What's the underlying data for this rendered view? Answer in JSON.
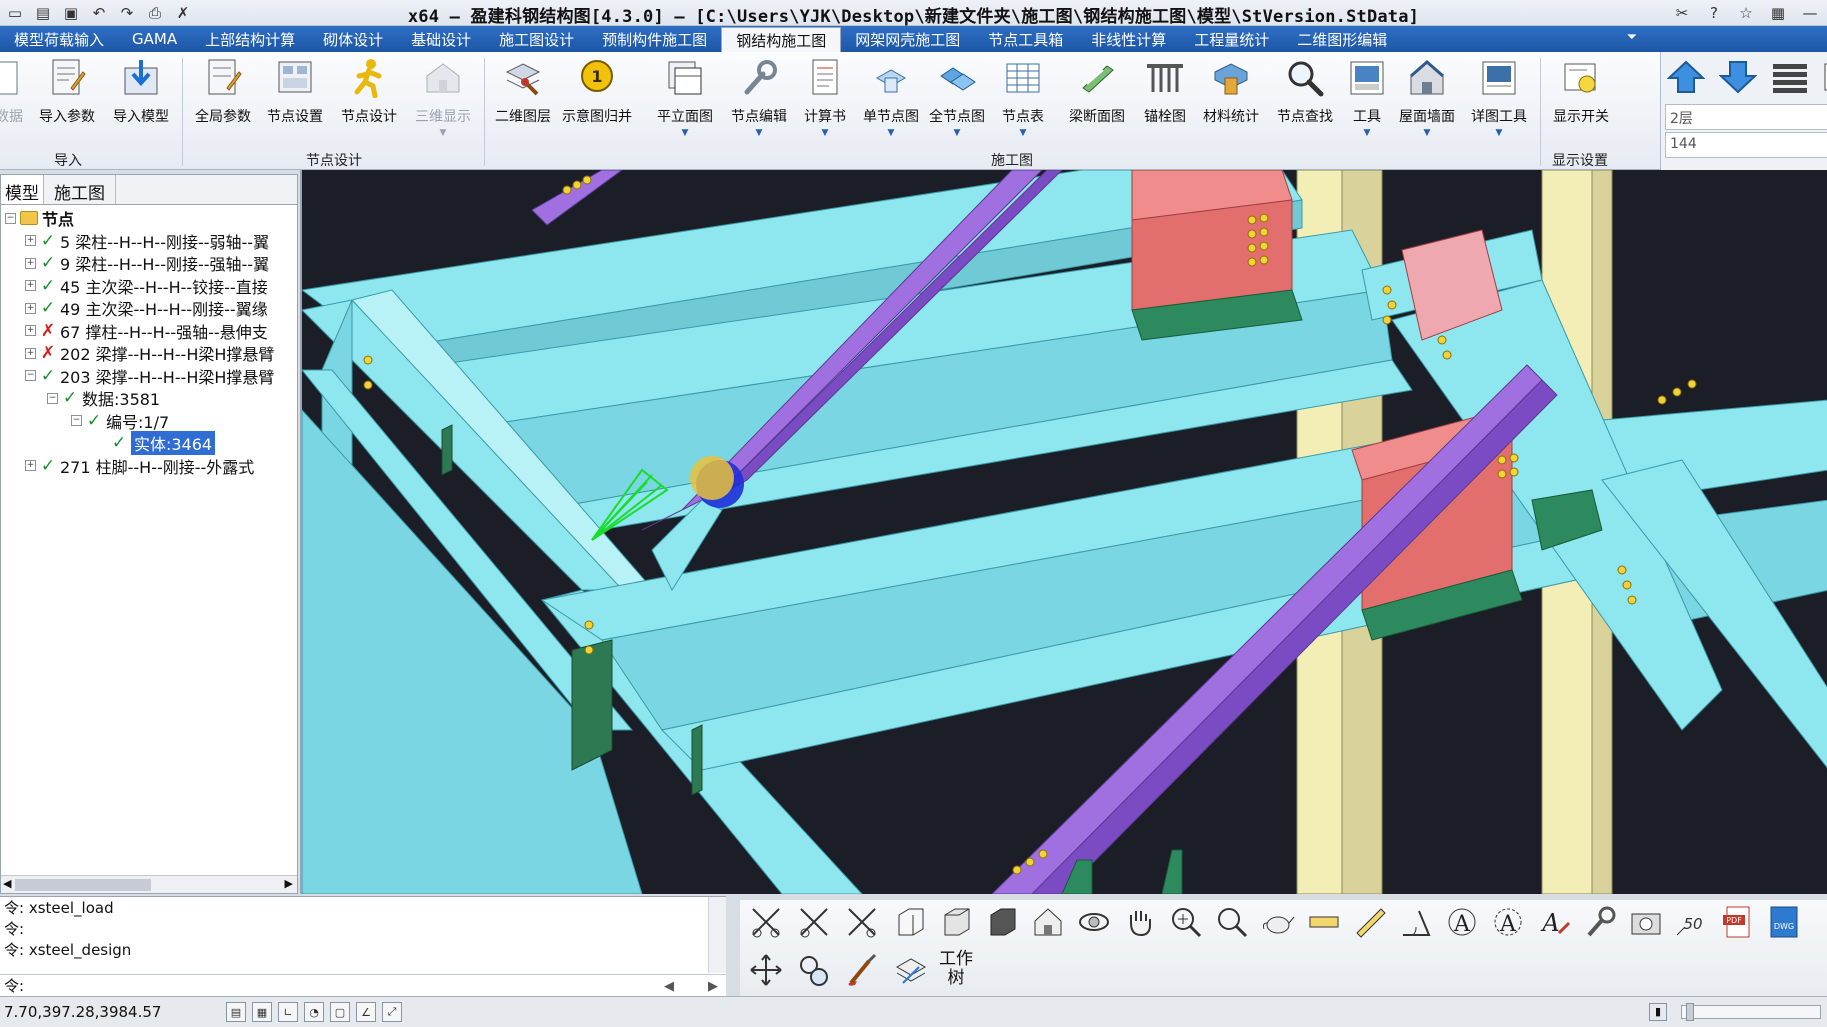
{
  "window": {
    "title": "x64 – 盈建科钢结构图[4.3.0] – [C:\\Users\\YJK\\Desktop\\新建文件夹\\施工图\\钢结构施工图\\模型\\StVersion.StData]"
  },
  "tabs": [
    "模型荷载输入",
    "GAMA",
    "上部结构计算",
    "砌体设计",
    "基础设计",
    "施工图设计",
    "预制构件施工图",
    "钢结构施工图",
    "网架网壳施工图",
    "节点工具箱",
    "非线性计算",
    "工程量统计",
    "二维图形编辑"
  ],
  "active_tab": "钢结构施工图",
  "ribbon": {
    "buttons": {
      "b0": "数据",
      "b1": "导入参数",
      "b2": "导入模型",
      "b3": "全局参数",
      "b4": "节点设置",
      "b5": "节点设计",
      "b6": "三维显示",
      "b7": "二维图层",
      "b8": "示意图归并",
      "b9": "平立面图",
      "b10": "节点编辑",
      "b11": "计算书",
      "b12": "单节点图",
      "b13": "全节点图",
      "b14": "节点表",
      "b15": "梁断面图",
      "b16": "锚栓图",
      "b17": "材料统计",
      "b18": "节点查找",
      "b19": "工具",
      "b20": "屋面墙面",
      "b21": "详图工具",
      "b22": "显示开关"
    },
    "groups": {
      "import": "导入",
      "node_design": "节点设计",
      "construction": "施工图",
      "display": "显示设置"
    },
    "floor_select": "2层",
    "floor_value": "144"
  },
  "left_panel": {
    "tabs": [
      "模型",
      "施工图"
    ],
    "tree": {
      "root": "节点",
      "n1": "5 梁柱--H--H--刚接--弱轴--翼",
      "n2": "9 梁柱--H--H--刚接--强轴--翼",
      "n3": "45 主次梁--H--H--铰接--直接",
      "n4": "49 主次梁--H--H--刚接--翼缘",
      "n5": "67 撑柱--H--H--强轴--悬伸支",
      "n6": "202 梁撑--H--H--H梁H撑悬臂",
      "n7": "203 梁撑--H--H--H梁H撑悬臂",
      "n7a": "数据:3581",
      "n7b": "编号:1/7",
      "n7c": "实体:3464",
      "n8": "271 柱脚--H--刚接--外露式"
    }
  },
  "command": {
    "prompt": "令:",
    "lines": [
      "xsteel_load",
      "",
      "xsteel_design",
      ""
    ]
  },
  "bottom_toolbar": {
    "tree_label": "工作\n树",
    "zoom_val": "50"
  },
  "status": {
    "coords": "7.70,397.28,3984.57"
  },
  "colors": {
    "beam": "#8ee6ee",
    "brace": "#a070e0",
    "column": "#f3edb6",
    "plate_red": "#f08c8c",
    "plate_green": "#2d8a5e",
    "bolt": "#f2d23a",
    "background": "#1b1e27"
  }
}
